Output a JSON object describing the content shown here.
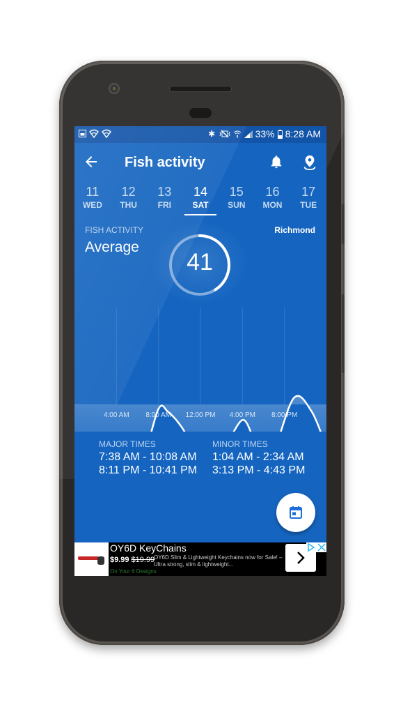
{
  "status_bar": {
    "left_icons": [
      "image-notification-icon",
      "wifi-notification-icon",
      "wifi-notification-icon"
    ],
    "right_icons": [
      "bluetooth-icon",
      "vibrate-mute-icon",
      "wifi-icon",
      "signal-icon"
    ],
    "battery": "33%",
    "time": "8:28 AM"
  },
  "toolbar": {
    "title": "Fish activity",
    "back_icon": "arrow-left-icon",
    "notification_icon": "bell-icon",
    "location_icon": "location-pin-icon"
  },
  "days": [
    {
      "num": "11",
      "dow": "WED",
      "selected": false
    },
    {
      "num": "12",
      "dow": "THU",
      "selected": false
    },
    {
      "num": "13",
      "dow": "FRI",
      "selected": false
    },
    {
      "num": "14",
      "dow": "SAT",
      "selected": true
    },
    {
      "num": "15",
      "dow": "SUN",
      "selected": false
    },
    {
      "num": "16",
      "dow": "MON",
      "selected": false
    },
    {
      "num": "17",
      "dow": "TUE",
      "selected": false
    }
  ],
  "activity": {
    "label": "FISH ACTIVITY",
    "level": "Average",
    "location": "Richmond",
    "score": "41",
    "score_fraction": 0.41
  },
  "chart_data": {
    "type": "area",
    "title": "",
    "xlabel": "",
    "ylabel": "",
    "x_unit": "hour of day",
    "xlim": [
      0,
      24
    ],
    "ylim": [
      0,
      100
    ],
    "x_tick_labels": [
      "4:00 AM",
      "8:00 AM",
      "12:00 PM",
      "4:00 PM",
      "8:00 PM"
    ],
    "x_ticks": [
      4,
      8,
      12,
      16,
      20
    ],
    "grid": "vertical",
    "series": [
      {
        "name": "activity",
        "x": [
          0,
          1.6,
          2.2,
          3.5,
          5.4,
          6.5,
          8.0,
          8.9,
          10.1,
          11.0,
          12.0,
          13.4,
          14.4,
          16.0,
          17.0,
          17.6,
          18.2,
          18.9,
          20.9,
          22.6,
          24.0
        ],
        "y": [
          28,
          40,
          40,
          34,
          36,
          32,
          50,
          49,
          44,
          38,
          28,
          36,
          37,
          46,
          40,
          37,
          40,
          34,
          54,
          49,
          36
        ]
      }
    ]
  },
  "major_times": {
    "label": "MAJOR TIMES",
    "items": [
      "7:38 AM - 10:08 AM",
      "8:11 PM - 10:41 PM"
    ]
  },
  "minor_times": {
    "label": "MINOR TIMES",
    "items": [
      "1:04 AM - 2:34 AM",
      "3:13 PM - 4:43 PM"
    ]
  },
  "fab": {
    "icon": "calendar-icon"
  },
  "ad": {
    "title": "OY6D KeyChains",
    "price": "$9.99",
    "old_price": "$19.99",
    "description": "OY6D Slim & Lightweight Keychains now for Sale! – Ultra strong, slim & lightweight...",
    "source": "On Your 6 Designs",
    "cta_icon": "chevron-right-icon",
    "choices_icons": [
      "adchoices-icon",
      "close-icon"
    ]
  },
  "colors": {
    "primary": "#1565c0",
    "status_bar": "#1254a8",
    "accent": "#1e6fd9"
  }
}
